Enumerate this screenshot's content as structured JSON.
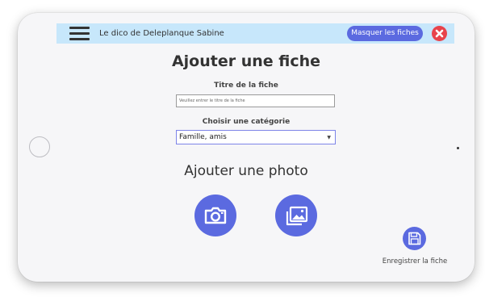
{
  "header": {
    "app_title": "Le dico de Deleplanque Sabine",
    "hide_button_label": "Masquer les fiches"
  },
  "form": {
    "page_title": "Ajouter une fiche",
    "title_label": "Titre de la fiche",
    "title_placeholder": "Veuillez entrer le titre de la fiche",
    "title_value": "",
    "category_label": "Choisir une catégorie",
    "category_selected": "Famille, amis",
    "photo_title": "Ajouter une photo",
    "save_label": "Enregistrer la fiche"
  },
  "icons": {
    "menu": "hamburger-menu-icon",
    "close": "close-icon",
    "camera": "camera-icon",
    "gallery": "image-gallery-icon",
    "save": "floppy-disk-icon"
  },
  "colors": {
    "accent": "#5b6ae0",
    "header_bg": "#c7e7fb",
    "close": "#e8434b"
  }
}
